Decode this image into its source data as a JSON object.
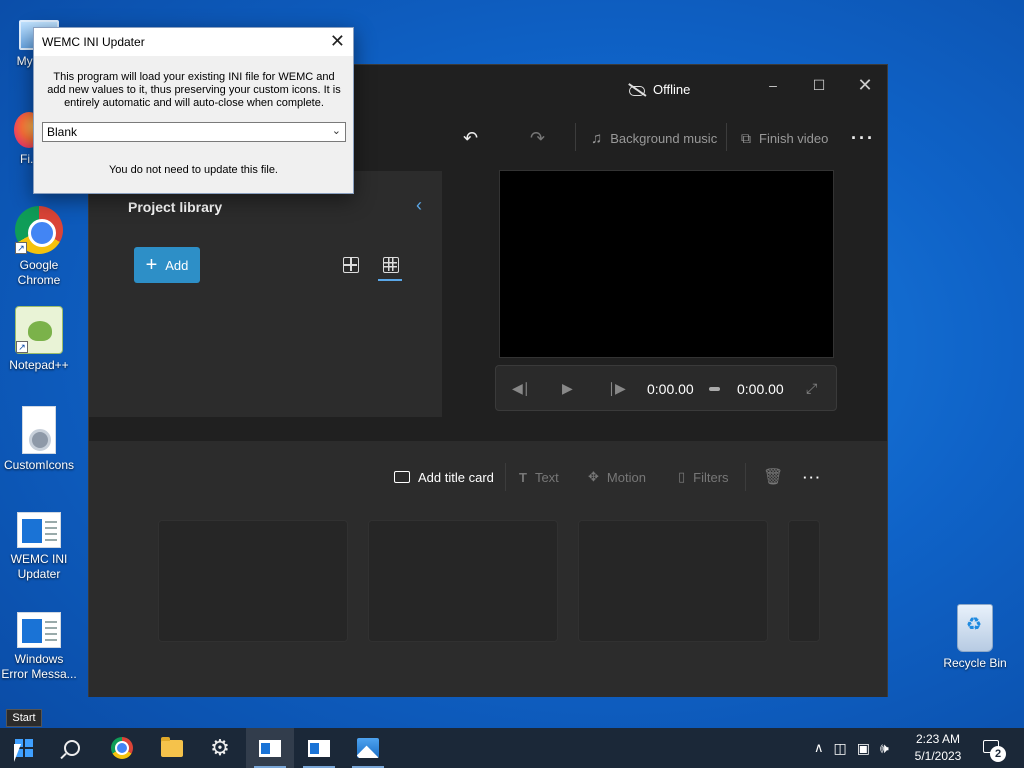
{
  "desktop": {
    "icons": [
      {
        "label": "My Co..."
      },
      {
        "label": "Fi..."
      },
      {
        "label": "Google Chrome"
      },
      {
        "label": "Notepad++"
      },
      {
        "label": "CustomIcons"
      },
      {
        "label": "WEMC INI Updater"
      },
      {
        "label": "Windows Error Messa..."
      },
      {
        "label": "Recycle Bin"
      }
    ]
  },
  "editor": {
    "status": "Offline",
    "toolbar": {
      "background_music": "Background music",
      "finish_video": "Finish video"
    },
    "library": {
      "title": "Project library",
      "add_label": "Add"
    },
    "player": {
      "current_time": "0:00.00",
      "total_time": "0:00.00"
    },
    "storyboard": {
      "add_title_card": "Add title card",
      "text": "Text",
      "motion": "Motion",
      "filters": "Filters"
    }
  },
  "dialog": {
    "title": "WEMC INI Updater",
    "description": "This program will load your existing INI file for WEMC and add new values to it, thus preserving your custom icons. It is entirely automatic and will auto-close when complete.",
    "select_value": "Blank",
    "status": "You do not need to update this file."
  },
  "tooltip": "Start",
  "taskbar": {
    "clock_time": "2:23 AM",
    "clock_date": "5/1/2023",
    "notification_count": "2"
  },
  "colors": {
    "desktop_bg": "#0f63c8",
    "accent": "#2d8fc7",
    "editor_bg": "#202020",
    "taskbar_bg": "#1b2838"
  }
}
